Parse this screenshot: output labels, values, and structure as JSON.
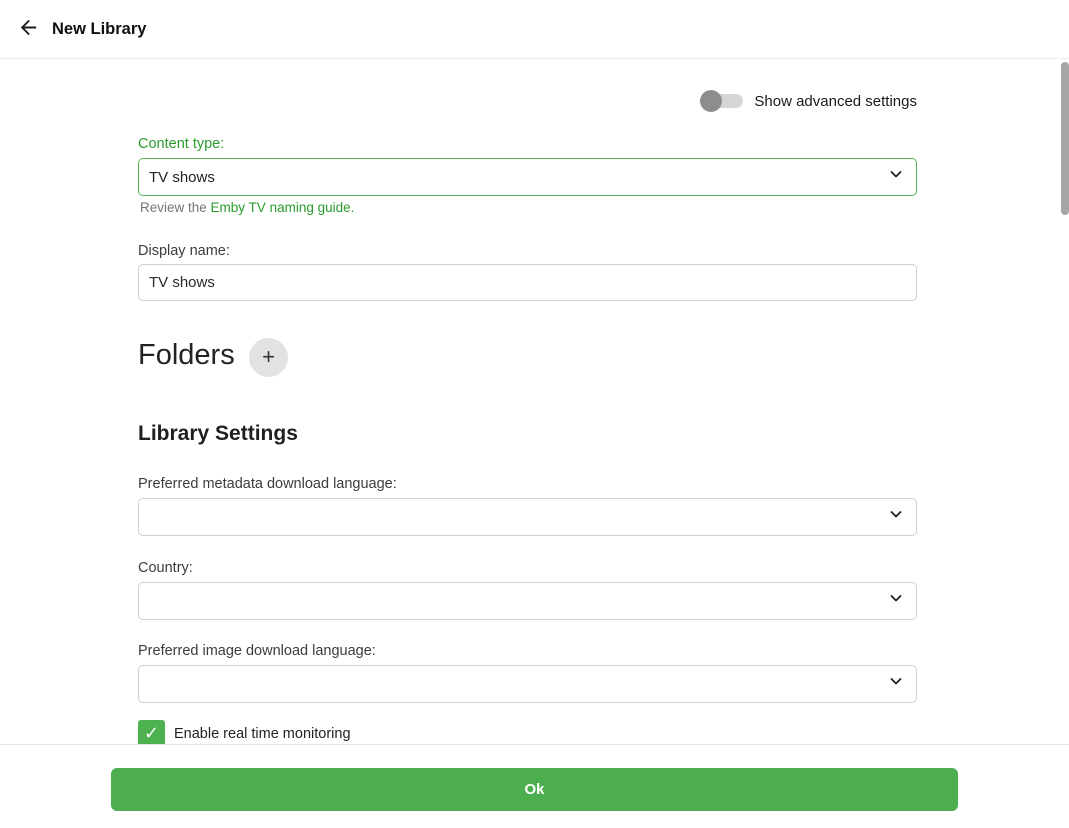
{
  "header": {
    "title": "New Library"
  },
  "advanced_toggle": {
    "label": "Show advanced settings",
    "state": "off"
  },
  "form": {
    "content_type": {
      "label": "Content type:",
      "value": "TV shows",
      "helper_prefix": "Review the ",
      "helper_link": "Emby TV naming guide."
    },
    "display_name": {
      "label": "Display name:",
      "value": "TV shows"
    },
    "folders": {
      "title": "Folders",
      "add_label": "+"
    },
    "library_settings": {
      "title": "Library Settings",
      "metadata_language": {
        "label": "Preferred metadata download language:",
        "value": ""
      },
      "country": {
        "label": "Country:",
        "value": ""
      },
      "image_language": {
        "label": "Preferred image download language:",
        "value": ""
      },
      "realtime_monitoring": {
        "label": "Enable real time monitoring",
        "checked": true,
        "check_glyph": "✓"
      }
    }
  },
  "footer": {
    "ok_label": "Ok"
  },
  "colors": {
    "accent_green": "#4cae4f",
    "label_green": "#2a9c2d",
    "border_green": "#55b457",
    "checkbox_green": "#4db14f"
  }
}
